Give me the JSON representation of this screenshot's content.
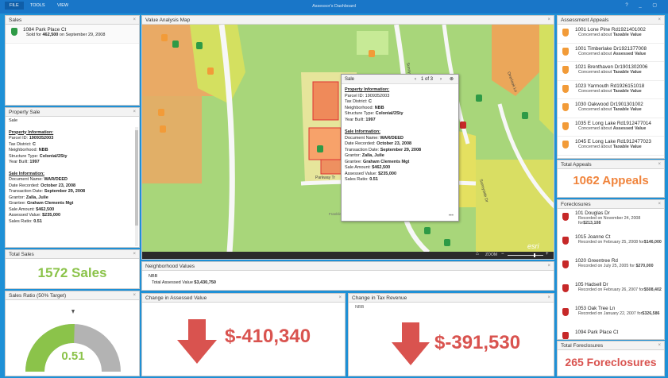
{
  "menu": {
    "file": "FILE",
    "tools": "TOOLS",
    "view": "VIEW"
  },
  "app_title": "Assessor's Dashboard",
  "window_controls": "? _ ▢",
  "sales": {
    "title": "Sales",
    "item_address": "1084 Park Place Ct",
    "item_prefix": "Sold for ",
    "item_amount": "462,500",
    "item_suffix": " on September 29, 2008"
  },
  "property_sale": {
    "title": "Property Sale",
    "subtitle": "Sale",
    "prop_heading": "Property Information:",
    "parcel_label": "Parcel ID: ",
    "parcel": "1909352003",
    "district_label": "Tax District: ",
    "district": "C",
    "neighborhood_label": "Neighborhood: ",
    "neighborhood": "NBB",
    "structure_label": "Structure Type: ",
    "structure": "Colonial/2Sty",
    "year_label": "Year Built: ",
    "year": "1997",
    "sale_heading": "Sale Information:",
    "doc_label": "Document Name: ",
    "doc": "WAR/DEED",
    "recorded_label": "Date Recorded: ",
    "recorded": "October 23, 2008",
    "transaction_label": "Transaction Date: ",
    "transaction": "September 29, 2008",
    "grantor_label": "Grantor: ",
    "grantor": "Zalla, Julie",
    "grantee_label": "Grantee: ",
    "grantee": "Graham Clements Mgt",
    "amount_label": "Sale Amount: ",
    "amount": "$462,500",
    "assessed_label": "Assessed Value: ",
    "assessed": "$235,000",
    "ratio_label": "Sales Ratio: ",
    "ratio": "0.51"
  },
  "total_sales": {
    "title": "Total Sales",
    "value": "1572 Sales"
  },
  "sales_ratio": {
    "title": "Sales Ratio (50% Target)",
    "value": "0.51",
    "fraction": 0.51
  },
  "map": {
    "title": "Value Analysis Map",
    "street_sunny": "Sunny",
    "street_overlook": "Overlook Ln",
    "street_sunnyside": "Sunnyside Dr",
    "street_parkway": "Parkway Tr",
    "school_label": "Franklin Chaffin Elem School",
    "zoom_label": "ZOOM",
    "esri": "esri",
    "home_icon": "⌂",
    "popup": {
      "title": "Sale",
      "pager": "1 of 3",
      "prop_heading": "Property Information:",
      "parcel": "Parcel ID: 1909352003",
      "district_label": "Tax District: ",
      "district": "C",
      "neighborhood_label": "Neighborhood: ",
      "neighborhood": "NBB",
      "structure_label": "Structure Type: ",
      "structure": "Colonial/2Sty",
      "year_label": "Year Built: ",
      "year": "1997",
      "sale_heading": "Sale Information:",
      "doc_label": "Document Name: ",
      "doc": "WAR/DEED",
      "recorded_label": "Date Recorded: ",
      "recorded": "October 23, 2008",
      "transaction_label": "Transaction Date: ",
      "transaction": "September 29, 2008",
      "grantor_label": "Grantor: ",
      "grantor": "Zalla, Julie",
      "grantee_label": "Grantee: ",
      "grantee": "Graham Clements Mgt",
      "amount_label": "Sale Amount: ",
      "amount": "$462,500",
      "assessed_label": "Assessed Value: ",
      "assessed": "$235,000",
      "ratio_label": "Sales Ratio: ",
      "ratio": "0.51",
      "more": "•••"
    }
  },
  "neighborhood": {
    "title": "Neighborhood Values",
    "name": "NBB",
    "total_label": "Total Assessed Value ",
    "total": "$3,430,750"
  },
  "assessed_change": {
    "title": "Change in Assessed Value",
    "value": "$-410,340"
  },
  "tax_change": {
    "title": "Change in Tax Revenue",
    "sub": "NBB",
    "value": "$-391,530"
  },
  "appeals": {
    "title": "Assessment Appeals",
    "items": [
      {
        "address": "1001 Lone Pine Rd1921401002",
        "prefix": "Concerned about ",
        "concern": "Taxable Value"
      },
      {
        "address": "1001 Timberlake Dr1921377008",
        "prefix": "Concerned about ",
        "concern": "Assessed Value"
      },
      {
        "address": "1021 Brenthaven Dr1901302006",
        "prefix": "Concerned about ",
        "concern": "Taxable Value"
      },
      {
        "address": "1023 Yarmouth Rd1926151018",
        "prefix": "Concerned about ",
        "concern": "Taxable Value"
      },
      {
        "address": "1030 Oakwood Dr1901301002",
        "prefix": "Concerned about ",
        "concern": "Taxable Value"
      },
      {
        "address": "1035 E Long Lake Rd1912477014",
        "prefix": "Concerned about ",
        "concern": "Assessed Value"
      },
      {
        "address": "1045 E Long Lake Rd1912477023",
        "prefix": "Concerned about ",
        "concern": "Taxable Value"
      }
    ]
  },
  "total_appeals": {
    "title": "Total Appeals",
    "value": "1062 Appeals"
  },
  "foreclosures": {
    "title": "Foreclosures",
    "items": [
      {
        "address": "101 Douglas Dr",
        "line": "Recorded on November 24, 2008 for",
        "amount": "$213,108"
      },
      {
        "address": "1015 Joanne Ct",
        "line": "Recorded on February 25, 2008 for",
        "amount": "$146,000"
      },
      {
        "address": "1020 Greentree Rd",
        "line": "Recorded on July 25, 2005 for ",
        "amount": "$270,000"
      },
      {
        "address": "105 Hadsell Dr",
        "line": "Recorded on February 26, 2007 for",
        "amount": "$508,402"
      },
      {
        "address": "1053 Oak Tree Ln",
        "line": "Recorded on January 22, 2007 for",
        "amount": "$326,586"
      },
      {
        "address": "1094 Park Place Ct",
        "line": "",
        "amount": ""
      }
    ]
  },
  "total_foreclosures": {
    "title": "Total Foreclosures",
    "value": "265 Foreclosures"
  },
  "colors": {
    "green": "#8bc34a",
    "orange": "#f0843c",
    "red": "#d9534f",
    "brand": "#1976c8"
  }
}
